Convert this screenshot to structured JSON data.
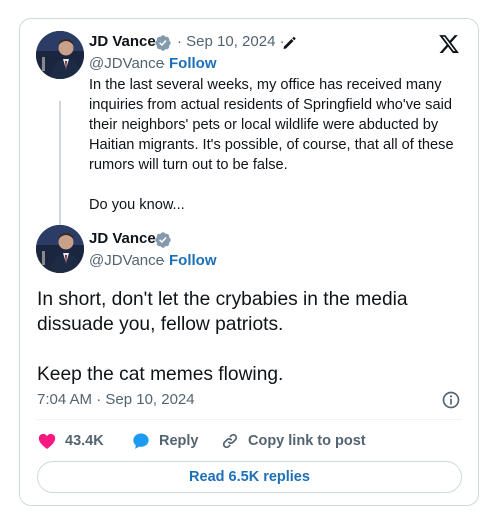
{
  "quoted_tweet": {
    "author_name": "JD Vance",
    "date_meta": "· Sep 10, 2024 ·",
    "handle": "@JDVance",
    "follow_sep": "·",
    "follow_label": "Follow",
    "text": "In the last several weeks, my office has received many inquiries from actual residents of Springfield who've said their neighbors' pets or local wildlife were abducted by Haitian migrants. It's possible, of course, that all of these rumors will turn out to be false.\n\nDo you know..."
  },
  "main_tweet": {
    "author_name": "JD Vance",
    "handle": "@JDVance",
    "follow_sep": "·",
    "follow_label": "Follow",
    "text": "In short, don't let the crybabies in the media dissuade you, fellow patriots.\n\nKeep the cat memes flowing.",
    "timestamp": "7:04 AM · Sep 10, 2024"
  },
  "actions": {
    "likes": "43.4K",
    "reply_label": "Reply",
    "copy_link_label": "Copy link to post"
  },
  "replies_button_label": "Read 6.5K replies",
  "colors": {
    "link_blue": "#1d70b8",
    "verified_badge": "#829aab",
    "like_heart": "#f91880",
    "reply_bubble": "#1d9bf0"
  },
  "icons": [
    "x-logo-icon",
    "verified-badge-icon",
    "edit-icon",
    "info-icon",
    "heart-icon",
    "reply-icon",
    "link-icon"
  ]
}
